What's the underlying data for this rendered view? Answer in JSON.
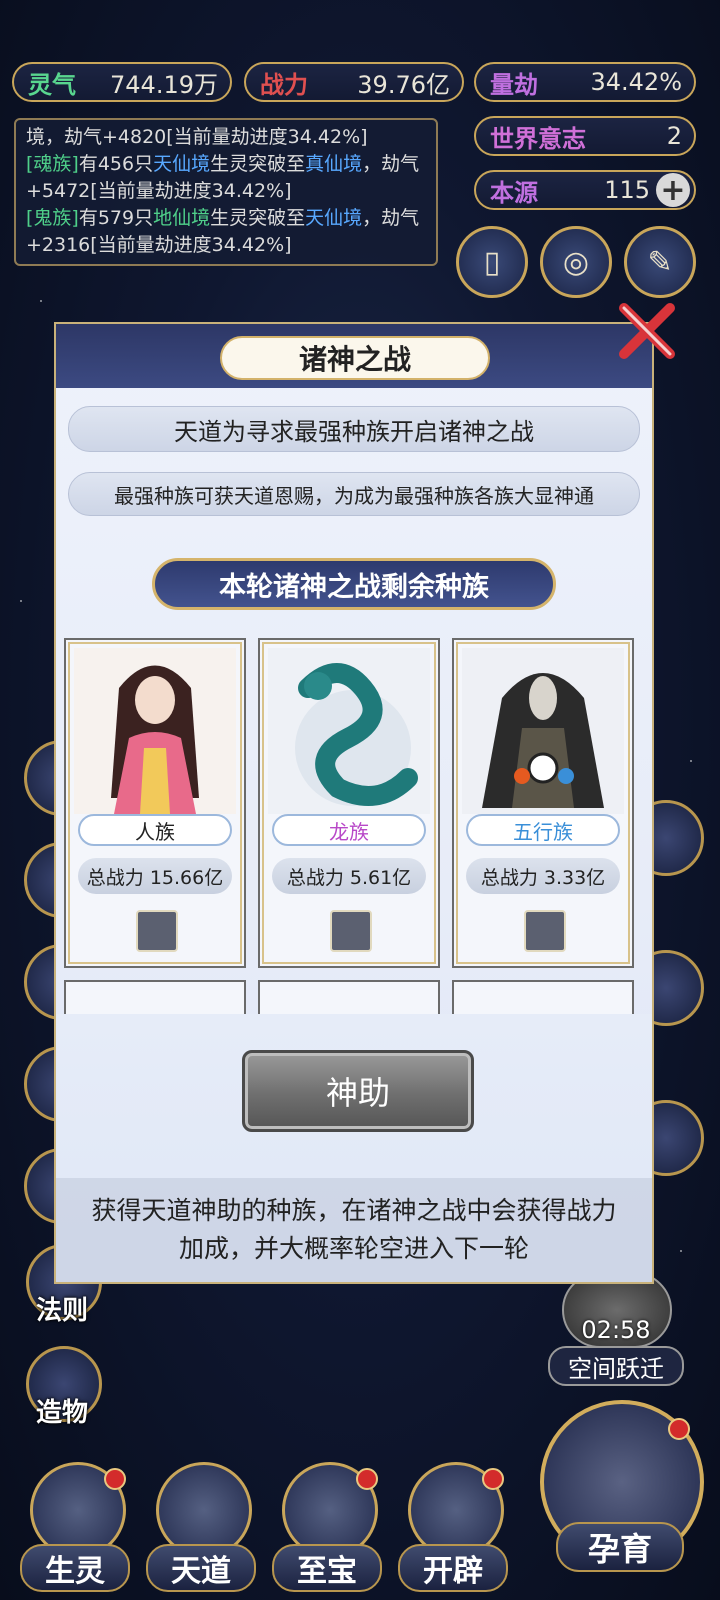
{
  "stats": {
    "lingqi": {
      "label": "灵气",
      "value": "744.19万"
    },
    "zhanli": {
      "label": "战力",
      "value": "39.76亿"
    },
    "liangjie": {
      "label": "量劫",
      "value": "34.42%"
    },
    "world_will": {
      "label": "世界意志",
      "value": "2"
    },
    "benyuan": {
      "label": "本源",
      "value": "115"
    }
  },
  "log": {
    "line1": "境，劫气+4820[当前量劫进度34.42%]",
    "entry2": {
      "race": "[魂族]",
      "text1": "有456只",
      "realm_from": "天仙境",
      "text2": "生灵突破至",
      "realm_to": "真仙境",
      "text3": "，劫气+5472[当前量劫进度34.42%]"
    },
    "entry3": {
      "race": "[鬼族]",
      "text1": "有579只",
      "realm_from": "地仙境",
      "text2": "生灵突破至",
      "realm_to": "天仙境",
      "text3": "，劫气+2316[当前量劫进度34.42%]"
    }
  },
  "modal": {
    "title": "诸神之战",
    "line1": "天道为寻求最强种族开启诸神之战",
    "line2": "最强种族可获天道恩赐，为成为最强种族各族大显神通",
    "section": "本轮诸神之战剩余种族",
    "races": [
      {
        "name": "人族",
        "name_color": "#222222",
        "power": "总战力 15.66亿"
      },
      {
        "name": "龙族",
        "name_color": "#b848c8",
        "power": "总战力 5.61亿"
      },
      {
        "name": "五行族",
        "name_color": "#3a8fd8",
        "power": "总战力 3.33亿"
      }
    ],
    "help_button": "神助",
    "description": "获得天道神助的种族，在诸神之战中会获得战力加成，并大概率轮空进入下一轮"
  },
  "side_left": {
    "fa_ze": "法则",
    "zao_wu": "造物"
  },
  "side_right": {
    "timer": "02:58",
    "space_jump": "空间跃迁"
  },
  "bottom_nav": [
    "生灵",
    "天道",
    "至宝",
    "开辟"
  ],
  "bottom_main": "孕育",
  "icons": {
    "close": "close-icon",
    "plus": "plus-icon"
  }
}
